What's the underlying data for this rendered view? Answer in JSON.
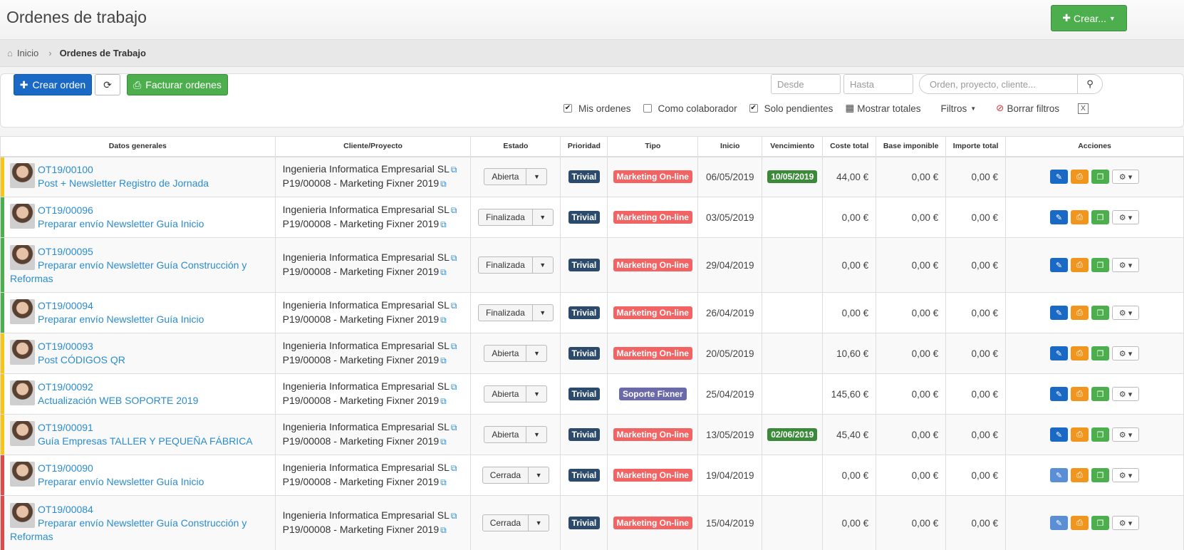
{
  "header": {
    "title": "Ordenes de trabajo",
    "create_label": "Crear..."
  },
  "breadcrumb": {
    "home": "Inicio",
    "current": "Ordenes de Trabajo"
  },
  "toolbar": {
    "new_order": "Crear orden",
    "invoice": "Facturar ordenes",
    "from_placeholder": "Desde",
    "to_placeholder": "Hasta",
    "search_placeholder": "Orden, proyecto, cliente...",
    "mis_ordenes": "Mis ordenes",
    "colaborador": "Como colaborador",
    "pendientes": "Solo pendientes",
    "totales": "Mostrar totales",
    "filtros": "Filtros",
    "borrar": "Borrar filtros"
  },
  "columns": [
    "Datos generales",
    "Cliente/Proyecto",
    "Estado",
    "Prioridad",
    "Tipo",
    "Inicio",
    "Vencimiento",
    "Coste total",
    "Base imponible",
    "Importe total",
    "Acciones"
  ],
  "rows": [
    {
      "code": "OT19/00100",
      "title": "Post + Newsletter Registro de Jornada",
      "client": "Ingenieria Informatica Empresarial SL",
      "project": "P19/00008 - Marketing Fixner 2019",
      "status": "Abierta",
      "priority": "Trivial",
      "type": "Marketing On-line",
      "start": "06/05/2019",
      "due": "10/05/2019",
      "cost": "44,00 €",
      "base": "0,00 €",
      "total": "0,00 €"
    },
    {
      "code": "OT19/00096",
      "title": "Preparar envío Newsletter Guía Inicio",
      "client": "Ingenieria Informatica Empresarial SL",
      "project": "P19/00008 - Marketing Fixner 2019",
      "status": "Finalizada",
      "priority": "Trivial",
      "type": "Marketing On-line",
      "start": "03/05/2019",
      "due": "",
      "cost": "0,00 €",
      "base": "0,00 €",
      "total": "0,00 €"
    },
    {
      "code": "OT19/00095",
      "title": "Preparar envío Newsletter Guía Construcción y Reformas",
      "client": "Ingenieria Informatica Empresarial SL",
      "project": "P19/00008 - Marketing Fixner 2019",
      "status": "Finalizada",
      "priority": "Trivial",
      "type": "Marketing On-line",
      "start": "29/04/2019",
      "due": "",
      "cost": "0,00 €",
      "base": "0,00 €",
      "total": "0,00 €"
    },
    {
      "code": "OT19/00094",
      "title": "Preparar envío Newsletter Guía Inicio",
      "client": "Ingenieria Informatica Empresarial SL",
      "project": "P19/00008 - Marketing Fixner 2019",
      "status": "Finalizada",
      "priority": "Trivial",
      "type": "Marketing On-line",
      "start": "26/04/2019",
      "due": "",
      "cost": "0,00 €",
      "base": "0,00 €",
      "total": "0,00 €"
    },
    {
      "code": "OT19/00093",
      "title": "Post CÓDIGOS QR",
      "client": "Ingenieria Informatica Empresarial SL",
      "project": "P19/00008 - Marketing Fixner 2019",
      "status": "Abierta",
      "priority": "Trivial",
      "type": "Marketing On-line",
      "start": "20/05/2019",
      "due": "",
      "cost": "10,60 €",
      "base": "0,00 €",
      "total": "0,00 €"
    },
    {
      "code": "OT19/00092",
      "title": "Actualización WEB SOPORTE 2019",
      "client": "Ingenieria Informatica Empresarial SL",
      "project": "P19/00008 - Marketing Fixner 2019",
      "status": "Abierta",
      "priority": "Trivial",
      "type": "Soporte Fixner",
      "start": "25/04/2019",
      "due": "",
      "cost": "145,60 €",
      "base": "0,00 €",
      "total": "0,00 €"
    },
    {
      "code": "OT19/00091",
      "title": "Guía Empresas TALLER Y PEQUEÑA FÁBRICA",
      "client": "Ingenieria Informatica Empresarial SL",
      "project": "P19/00008 - Marketing Fixner 2019",
      "status": "Abierta",
      "priority": "Trivial",
      "type": "Marketing On-line",
      "start": "13/05/2019",
      "due": "02/06/2019",
      "cost": "45,40 €",
      "base": "0,00 €",
      "total": "0,00 €"
    },
    {
      "code": "OT19/00090",
      "title": "Preparar envío Newsletter Guía Inicio",
      "client": "Ingenieria Informatica Empresarial SL",
      "project": "P19/00008 - Marketing Fixner 2019",
      "status": "Cerrada",
      "priority": "Trivial",
      "type": "Marketing On-line",
      "start": "19/04/2019",
      "due": "",
      "cost": "0,00 €",
      "base": "0,00 €",
      "total": "0,00 €"
    },
    {
      "code": "OT19/00084",
      "title": "Preparar envío Newsletter Guía Construcción y Reformas",
      "client": "Ingenieria Informatica Empresarial SL",
      "project": "P19/00008 - Marketing Fixner 2019",
      "status": "Cerrada",
      "priority": "Trivial",
      "type": "Marketing On-line",
      "start": "15/04/2019",
      "due": "",
      "cost": "0,00 €",
      "base": "0,00 €",
      "total": "0,00 €"
    }
  ],
  "colors": {
    "primary": "#1a69c4",
    "success": "#4cae4c",
    "open": "#f5c518",
    "finished": "#4cae4c",
    "closed": "#e04a4a"
  }
}
